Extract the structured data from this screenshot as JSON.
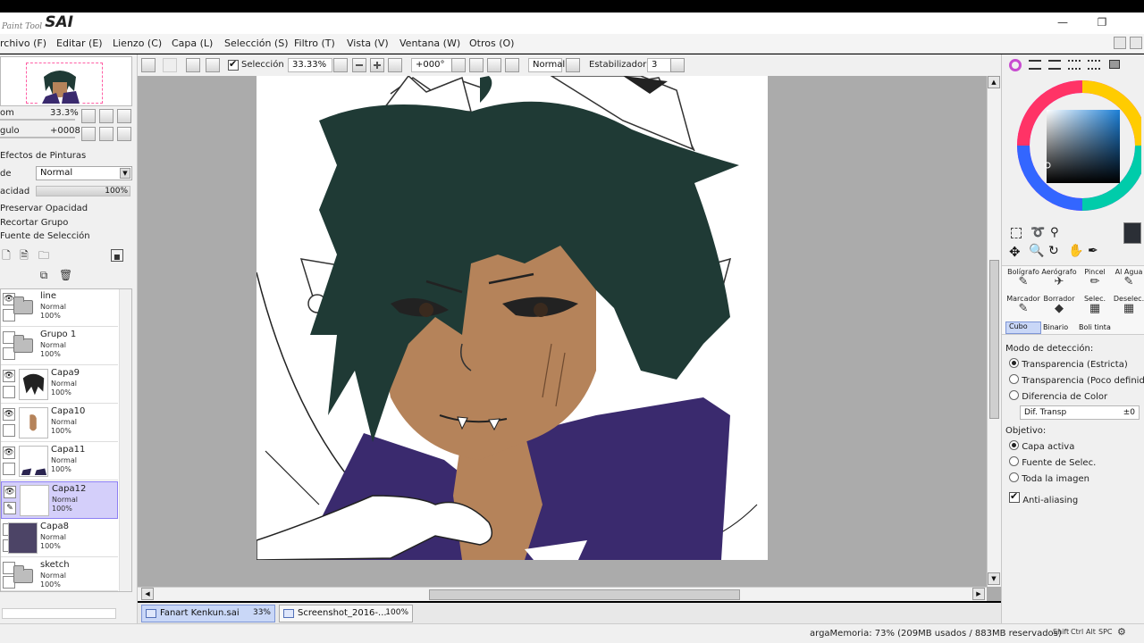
{
  "app": {
    "logo_small": "Paint Tool",
    "logo_big": "SAI",
    "window_controls": [
      "—",
      "❐"
    ]
  },
  "menu": [
    "rchivo (F)",
    "Editar (E)",
    "Lienzo (C)",
    "Capa (L)",
    "Selección (S)",
    "Filtro (T)",
    "Vista (V)",
    "Ventana (W)",
    "Otros (O)"
  ],
  "toolbar": {
    "selection_label": "Selección",
    "zoom_value": "33.33%",
    "angle_value": "+000°",
    "blend_mode": "Normal",
    "stabilizer_label": "Estabilizador",
    "stabilizer_value": "3"
  },
  "navigator": {
    "zoom_label": "om",
    "zoom_value": "33.3%",
    "angle_label": "gulo",
    "angle_value": "+0008"
  },
  "layer_props": {
    "effects_label": "Efectos de Pinturas",
    "mode_label": "de",
    "mode_value": "Normal",
    "opacity_label": "acidad",
    "opacity_value": "100%",
    "preserve_opacity": "Preservar Opacidad",
    "clip_group": "Recortar Grupo",
    "selection_source": "Fuente de Selección"
  },
  "layers": [
    {
      "name": "line",
      "mode": "Normal",
      "opacity": "100%",
      "type": "folder"
    },
    {
      "name": "Grupo 1",
      "mode": "Normal",
      "opacity": "100%",
      "type": "folder"
    },
    {
      "name": "Capa9",
      "mode": "Normal",
      "opacity": "100%",
      "type": "layer"
    },
    {
      "name": "Capa10",
      "mode": "Normal",
      "opacity": "100%",
      "type": "layer"
    },
    {
      "name": "Capa11",
      "mode": "Normal",
      "opacity": "100%",
      "type": "layer"
    },
    {
      "name": "Capa12",
      "mode": "Normal",
      "opacity": "100%",
      "type": "layer",
      "selected": true
    },
    {
      "name": "Capa8",
      "mode": "Normal",
      "opacity": "100%",
      "type": "layer"
    },
    {
      "name": "sketch",
      "mode": "Normal",
      "opacity": "100%",
      "type": "folder"
    }
  ],
  "tools": {
    "row1": [
      "Bolígrafo",
      "Aerógrafo",
      "Pincel",
      "Al Agua"
    ],
    "row2": [
      "Marcador",
      "Borrador",
      "Selec.",
      "Deselec."
    ],
    "row3": [
      "Cubo",
      "Binario",
      "Boli tinta"
    ]
  },
  "bucket_options": {
    "detection_label": "Modo de detección:",
    "detect_options": [
      "Transparencia (Estricta)",
      "Transparencia (Poco definida)",
      "Diferencia de Color"
    ],
    "dif_label": "Dif. Transp",
    "dif_value": "±0",
    "target_label": "Objetivo:",
    "target_options": [
      "Capa activa",
      "Fuente de Selec.",
      "Toda la imagen"
    ],
    "antialias_label": "Anti-aliasing"
  },
  "documents": [
    {
      "name": "Fanart Kenkun.sai",
      "zoom": "33%",
      "active": true
    },
    {
      "name": "Screenshot_2016-...",
      "zoom": "100%",
      "active": false
    }
  ],
  "status": {
    "memory": "argaMemoria: 73% (209MB usados / 883MB reservados)",
    "keys": [
      "Shift",
      "Ctrl",
      "Alt",
      "SPC"
    ]
  },
  "colors": {
    "hair": "#1f3a35",
    "skin": "#b5835a",
    "coat": "#3a2a6e",
    "layer_selected": "#d4cffa",
    "accent": "#8d7ff2"
  }
}
